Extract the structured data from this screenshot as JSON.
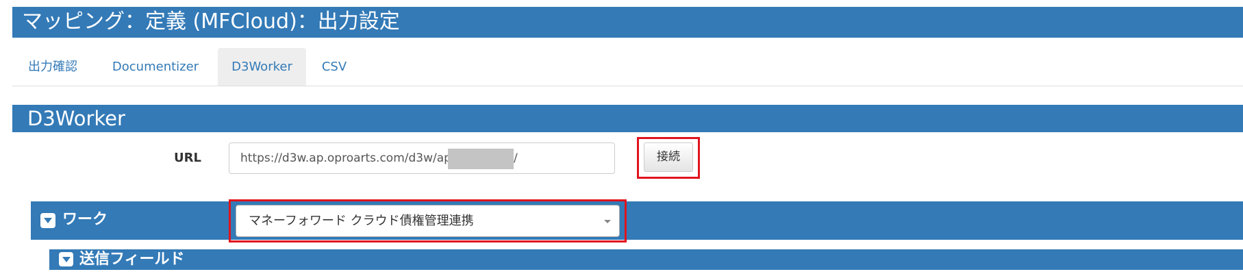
{
  "header": {
    "title": "マッピング：定義 (MFCloud)：出力設定"
  },
  "tabs": [
    {
      "label": "出力確認",
      "active": false
    },
    {
      "label": "Documentizer",
      "active": false
    },
    {
      "label": "D3Worker",
      "active": true
    },
    {
      "label": "CSV",
      "active": false
    }
  ],
  "section": {
    "title": "D3Worker"
  },
  "url_field": {
    "label": "URL",
    "value_visible": "https://d3w.ap.oproarts.com/d3w/api",
    "value_suffix": "/"
  },
  "connect_button": {
    "label": "接続"
  },
  "work": {
    "label": "ワーク",
    "icon": "collapse-toggle-icon",
    "selected": "マネーフォワード クラウド債権管理連携"
  },
  "send_fields": {
    "label": "送信フィールド",
    "icon": "collapse-toggle-icon"
  },
  "colors": {
    "primary": "#337ab7",
    "highlight": "#e0141e",
    "redaction": "#c4c4c4"
  }
}
